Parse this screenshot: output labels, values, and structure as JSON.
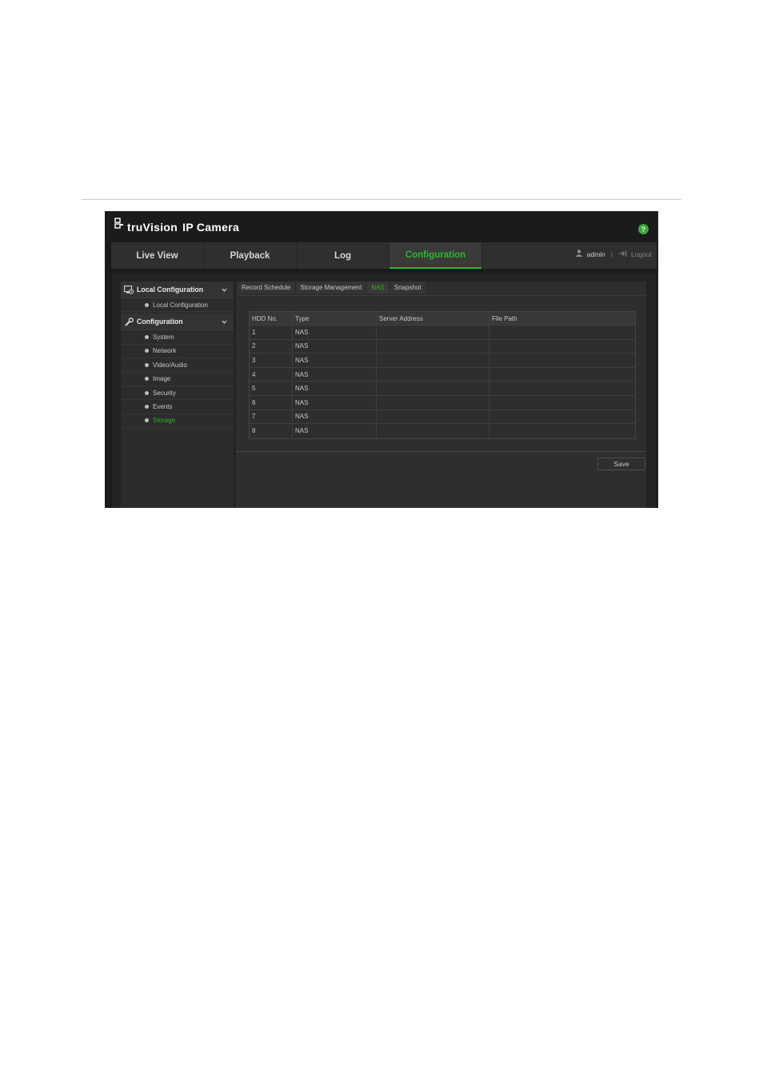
{
  "header": {
    "brand": "truVision",
    "product": "IP Camera",
    "help_label": "?"
  },
  "nav": {
    "tabs": [
      {
        "label": "Live View",
        "active": false
      },
      {
        "label": "Playback",
        "active": false
      },
      {
        "label": "Log",
        "active": false
      },
      {
        "label": "Configuration",
        "active": true
      }
    ],
    "user": "admin",
    "separator": "|",
    "logout": "Logout"
  },
  "sidebar": {
    "sections": [
      {
        "title": "Local Configuration",
        "icon": "local-config-icon",
        "items": [
          "Local Configuration"
        ]
      },
      {
        "title": "Configuration",
        "icon": "wrench-icon",
        "items": [
          "System",
          "Network",
          "Video/Audio",
          "Image",
          "Security",
          "Events",
          "Storage"
        ]
      }
    ],
    "active_item": "Storage"
  },
  "subtabs": [
    {
      "label": "Record Schedule",
      "active": false
    },
    {
      "label": "Storage Management",
      "active": false
    },
    {
      "label": "NAS",
      "active": true
    },
    {
      "label": "Snapshot",
      "active": false
    }
  ],
  "table": {
    "headers": [
      "HDD No.",
      "Type",
      "Server Address",
      "File Path"
    ],
    "rows": [
      [
        "1",
        "NAS",
        "",
        ""
      ],
      [
        "2",
        "NAS",
        "",
        ""
      ],
      [
        "3",
        "NAS",
        "",
        ""
      ],
      [
        "4",
        "NAS",
        "",
        ""
      ],
      [
        "5",
        "NAS",
        "",
        ""
      ],
      [
        "6",
        "NAS",
        "",
        ""
      ],
      [
        "7",
        "NAS",
        "",
        ""
      ],
      [
        "8",
        "NAS",
        "",
        ""
      ]
    ]
  },
  "save_label": "Save",
  "colors": {
    "accent": "#2fb52f",
    "background": "#1b1b1b",
    "text": "#c8c8c8"
  }
}
